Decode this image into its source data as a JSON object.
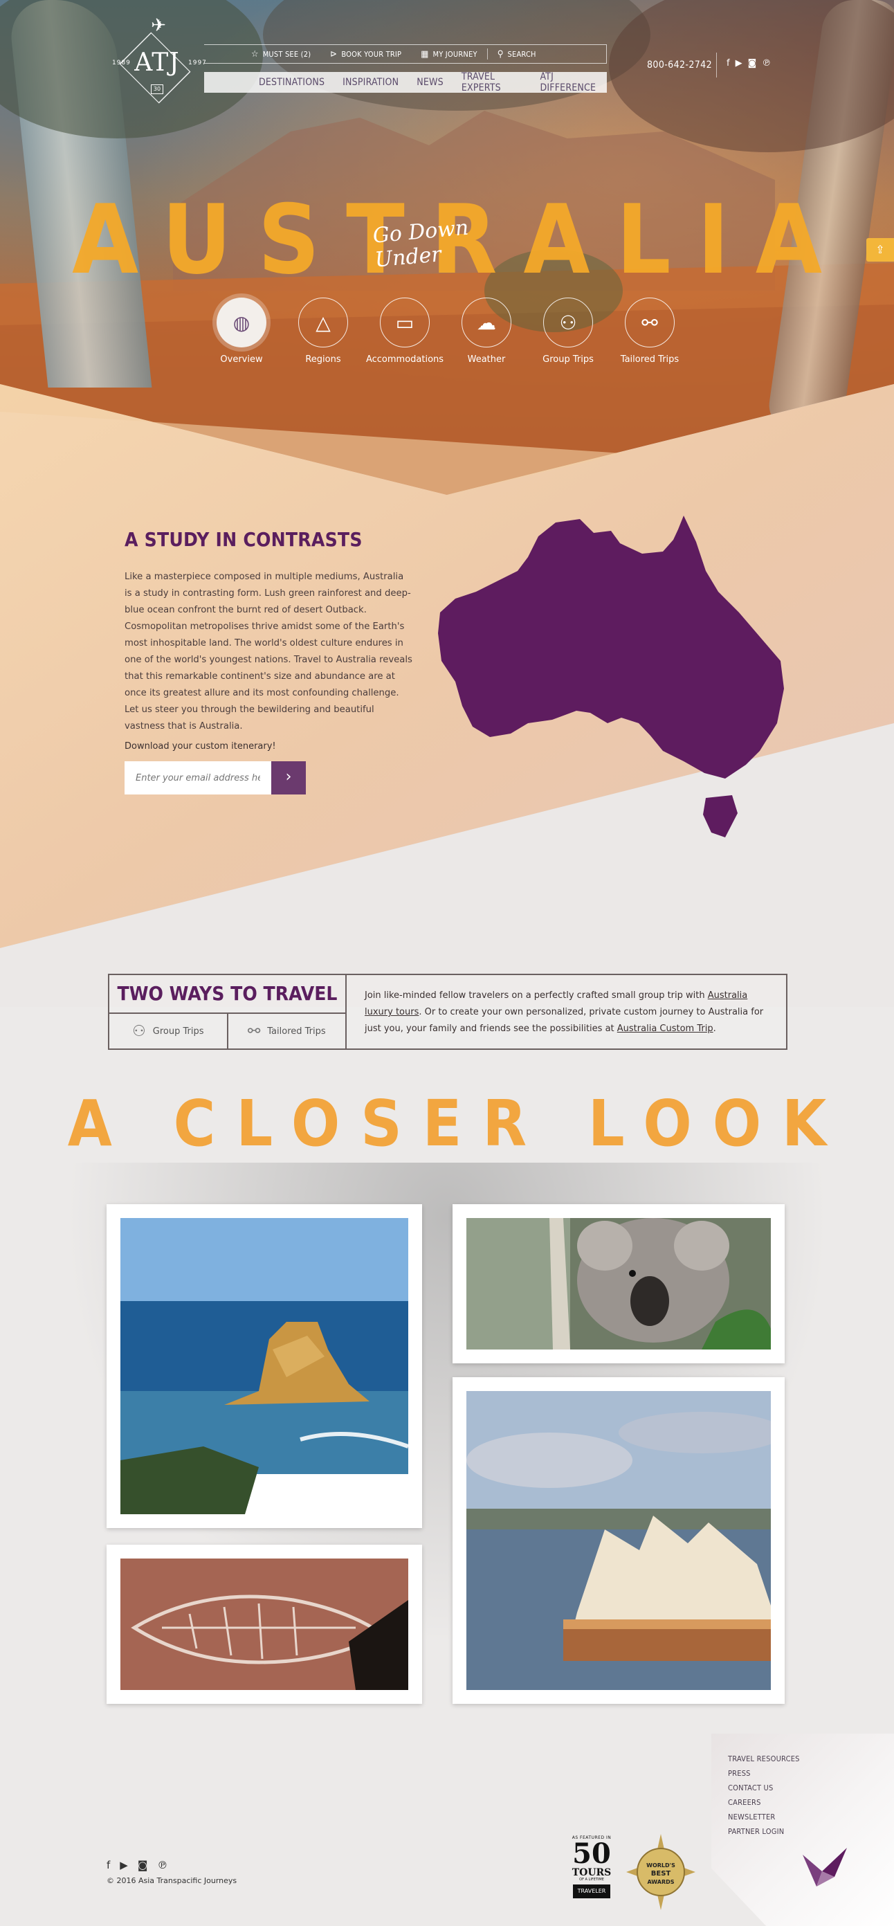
{
  "header": {
    "logo": {
      "letters": "ATJ",
      "year_left": "1989",
      "year_right": "1997",
      "badge": "30"
    },
    "utility": [
      {
        "icon": "star-icon",
        "label": "MUST SEE (2)"
      },
      {
        "icon": "tag-icon",
        "label": "BOOK YOUR TRIP"
      },
      {
        "icon": "map-icon",
        "label": "MY JOURNEY"
      },
      {
        "icon": "search-icon",
        "label": "SEARCH"
      }
    ],
    "nav": [
      "DESTINATIONS",
      "INSPIRATION",
      "NEWS",
      "TRAVEL EXPERTS",
      "ATJ DIFFERENCE"
    ],
    "phone": "800-642-2742"
  },
  "hero": {
    "title": "AUSTRALIA",
    "subtitle": "Go Down Under",
    "sections": [
      {
        "label": "Overview",
        "icon": "globe-icon",
        "active": true
      },
      {
        "label": "Regions",
        "icon": "mountain-icon"
      },
      {
        "label": "Accommodations",
        "icon": "bed-icon"
      },
      {
        "label": "Weather",
        "icon": "cloud-icon"
      },
      {
        "label": "Group Trips",
        "icon": "group-icon"
      },
      {
        "label": "Tailored Trips",
        "icon": "route-icon"
      }
    ]
  },
  "contrasts": {
    "title": "A STUDY IN CONTRASTS",
    "body": "Like a masterpiece composed in multiple mediums, Australia is a study in contrasting form. Lush green rainforest and deep-blue ocean confront the burnt red of desert Outback. Cosmopolitan metropolises thrive amidst some of the Earth's most inhospitable land. The world's oldest culture endures in one of the world's youngest nations. Travel to Australia reveals that this remarkable continent's size and abundance are at once its greatest allure and its most confounding challenge. Let us steer you through the bewildering and beautiful vastness that is Australia.",
    "download_label": "Download your custom itenerary!",
    "email_placeholder": "Enter your email address here",
    "map_color": "#5e1c5f"
  },
  "two_ways": {
    "title": "TWO WAYS TO TRAVEL",
    "options": [
      "Group Trips",
      "Tailored Trips"
    ],
    "text_1": "Join like-minded fellow travelers on a perfectly crafted small group trip with ",
    "link_1": "Australia luxury tours",
    "text_2": ". Or to create your own personalized, private custom journey to Australia for just you, your family and friends see the possibilities at ",
    "link_2": "Australia Custom Trip",
    "text_3": "."
  },
  "closer": {
    "title": "A CLOSER LOOK",
    "photos": [
      "rock-stack-coast-photo",
      "koala-photo",
      "aboriginal-rock-art-photo",
      "sydney-opera-house-photo"
    ]
  },
  "footer": {
    "links": [
      "TRAVEL RESOURCES",
      "PRESS",
      "CONTACT US",
      "CAREERS",
      "NEWSLETTER",
      "PARTNER LOGIN"
    ],
    "copyright": "© 2016 Asia Transpacific Journeys",
    "badge": {
      "top": "AS FEATURED IN",
      "number": "50",
      "word": "TOURS",
      "sub": "OF A LIFETIME",
      "brand": "TRAVELER"
    },
    "award": {
      "line1": "WORLD'S",
      "line2": "BEST",
      "line3": "AWARDS"
    }
  },
  "colors": {
    "accent_orange": "#f4a92a",
    "purple": "#5a1e5e",
    "button_purple": "#6b3a6e"
  }
}
